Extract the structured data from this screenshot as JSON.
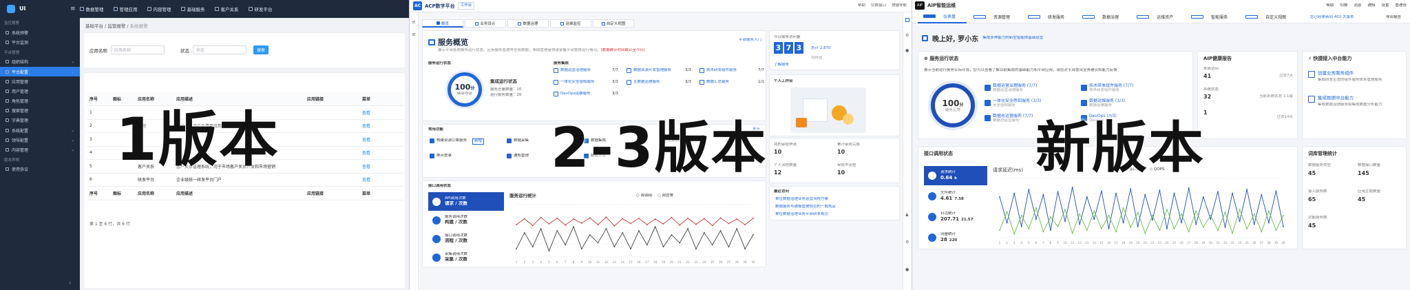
{
  "overlay": {
    "v1": "1版本",
    "v23": "2-3版本",
    "vnew": "新版本"
  },
  "p1": {
    "logo": "UI",
    "nav": [
      "数据管理",
      "管理应用",
      "内容管理",
      "基础服务",
      "客户关系",
      "研发平台"
    ],
    "side": [
      {
        "label": "监控报警",
        "type": "sec"
      },
      {
        "label": "系统预警",
        "type": "it"
      },
      {
        "label": "平台监测",
        "type": "it"
      },
      {
        "label": "平台管理",
        "type": "sec"
      },
      {
        "label": "组织结构",
        "type": "it",
        "chev": true
      },
      {
        "label": "平台配置",
        "type": "active",
        "chev": true
      },
      {
        "label": "应用管理",
        "type": "it"
      },
      {
        "label": "用户管理",
        "type": "it"
      },
      {
        "label": "角色管理",
        "type": "it"
      },
      {
        "label": "搜索管理",
        "type": "it"
      },
      {
        "label": "字典管理",
        "type": "it"
      },
      {
        "label": "系统配置",
        "type": "it",
        "chev": true
      },
      {
        "label": "领导配置",
        "type": "it",
        "chev": true
      },
      {
        "label": "内容管理",
        "type": "it",
        "chev": true
      },
      {
        "label": "版本声明",
        "type": "sec"
      },
      {
        "label": "使用协议",
        "type": "it"
      }
    ],
    "breadcrumb": [
      "基础平台",
      "监管报警",
      "系统报警"
    ],
    "filter": {
      "name_label": "应用名称",
      "name_ph": "应用名称",
      "status_label": "状态",
      "status_ph": "状态",
      "search": "搜索"
    },
    "columns": [
      "序号",
      "图标",
      "应用名称",
      "应用描述",
      "应用链接",
      "菜单"
    ],
    "rows": [
      [
        "1",
        "",
        "",
        "",
        "",
        "查看"
      ],
      [
        "2",
        "",
        "管理",
        "管理平台用户及费用应用配置等",
        "",
        "查看"
      ],
      [
        "3",
        "",
        "",
        "",
        "",
        "查看"
      ],
      [
        "4",
        "",
        "",
        "",
        "",
        "查看"
      ],
      [
        "5",
        "",
        "客户关系",
        "客户关系管理系统，用于市场客户关系开发和市场营销",
        "",
        "查看"
      ],
      [
        "6",
        "",
        "研发平台",
        "企业级统一研发平台门户",
        "",
        "查看"
      ]
    ],
    "footer_cols": [
      "序号",
      "图标",
      "应用名称",
      "应用描述",
      "应用链接",
      "菜单"
    ],
    "pager": "第 1 至 6 行，共 6 行"
  },
  "p2": {
    "brand": "ACP数字平台",
    "brand_tag": "工作台",
    "top_right": [
      "帮助",
      "切换窗口",
      "快捷导航"
    ],
    "tabs": [
      "概览",
      "业务设计",
      "数据治理",
      "运维监控",
      "自定义视图"
    ],
    "title": "服务概览",
    "subtitle": "展示平台各类服务运行状态、应用服务管理等全局数据，帮助管理者快速掌握平台整体运行情况。",
    "subtitle_note": "(数据统计时间截止至今日)",
    "entry": "平台服务入门",
    "counter_label": "今日服务访问量",
    "counter": [
      "3",
      "7",
      "3"
    ],
    "counter_side": "总计 2,870",
    "counter_sub": "月环比",
    "counter_link": "了解服务",
    "run_title": "服务运行状态",
    "ring_val": "100",
    "ring_unit": "分",
    "ring_sub": "健康等级",
    "run_info": [
      "集成运行状态",
      "服务总量数量：20",
      "运行服务数量：20"
    ],
    "svc_title": "服务集成",
    "svc": [
      [
        "数据运营治理服务",
        "7/7"
      ],
      [
        "数据资源开发管理服务",
        "3/3"
      ],
      [
        "技术研发组件服务",
        "7/7"
      ],
      [
        "一体化安全感知服务",
        "3/3"
      ],
      [
        "主数据治理服务",
        "3/3"
      ],
      [
        "数据汇总服务",
        "1/1"
      ],
      [
        "DevOps运维服务",
        "3/3"
      ]
    ],
    "apps_title": "常用功能",
    "apps_more": "更多",
    "apps": [
      "构建资源引擎服务",
      "新增",
      "数据采集",
      "数据集成",
      "主题模型",
      "单点登录",
      "通知管理",
      "数据开发"
    ],
    "workbench": "个人工作台",
    "stats": [
      [
        "我的审批申请",
        "10"
      ],
      [
        "累计审批完成",
        "10"
      ],
      [
        "个人流程数量",
        "12"
      ],
      [
        "审批中流程",
        "10"
      ]
    ],
    "links_title": "最近访问",
    "links": [
      "单位数据治理业务运营流程方案",
      "数据服务与通报管理规范的一般规定",
      "单位数据治理业务平台研发规范"
    ],
    "ops_title": "接口调用状态",
    "metrics": [
      [
        "API调用次数",
        "请求 / 次数"
      ],
      [
        "服务调用次数",
        "构建 / 次数"
      ],
      [
        "接口调用次数",
        "流程 / 次数"
      ],
      [
        "采集调用次数",
        "采集 / 次数"
      ]
    ],
    "chart_title": "服务运行统计",
    "legend": [
      "周调用",
      "周告警"
    ]
  },
  "p3": {
    "brand": "AIP智能运维",
    "top_right": [
      "帮助",
      "切换",
      "消息",
      "通知",
      "设置",
      "管理员"
    ],
    "menu": [
      "仪表盘",
      "资源管理",
      "研发服务",
      "数据治理",
      "运维资产",
      "智能服务",
      "自定义视图"
    ],
    "version": "您已经更新到 402 大版本",
    "export": "导出报告",
    "greet": "晚上好, 罗小东",
    "greet_sub": "集成多种能力的新型智能体基础运营",
    "run_title": "服务运行状态",
    "run_desc": "展示当前运行服务实际环境，您可以查看了解目前集成的基础能力和平台应用，请您对平台提出宝贵建议和能力反馈",
    "ring_val": "100",
    "ring_unit": "分",
    "ring_sub": "服务正常",
    "svc": [
      [
        "数据运营治理服务 (7/7)",
        "数据运营治理服务"
      ],
      [
        "技术研发组件服务 (7/7)",
        "技术研发组件服务"
      ],
      [
        "一体化安全感知服务 (3/3)",
        "安全感知服务"
      ],
      [
        "数据运维服务 (3/3)",
        "数据运维服务"
      ],
      [
        "数据总运营服务 (7/7)",
        "数据总运营服务"
      ],
      [
        "DevOps (3/3)",
        "DevOps"
      ]
    ],
    "report_title": "AIP健康报告",
    "report": [
      [
        "本周访问",
        "41",
        "过去7天"
      ],
      [
        "系统状态",
        "32",
        "当前系统状态 1.1版"
      ],
      [
        "",
        "1",
        "过去14天"
      ]
    ],
    "quick_title": "快捷接入中台能力",
    "quick": [
      [
        "创建业务服务组件",
        "集成研发生态的组件服务体系管理服务"
      ],
      [
        "集成数据中台能力",
        "集成数据治理服务和集成数据分析能力"
      ]
    ],
    "api_title": "接口调用状态",
    "metrics": [
      [
        "请求统计",
        "0.64",
        "k"
      ],
      [
        "文件统计",
        "4.61",
        "7.58"
      ],
      [
        "日活统计",
        "207.71",
        "21.57"
      ],
      [
        "流量统计",
        "28",
        "220"
      ]
    ],
    "chart_title": "请求延迟(ms)",
    "legend": [
      "接口调用",
      "QOPS"
    ],
    "dict_title": "词库管理统计",
    "dict": [
      [
        "数据服务类型",
        "45"
      ],
      [
        "数据接口数量",
        "145"
      ],
      [
        "接入服务数",
        "65"
      ],
      [
        "应用主题数量",
        "45"
      ],
      [
        "功能服务数",
        "45"
      ]
    ]
  },
  "chart_data": [
    {
      "type": "line",
      "title": "服务运行统计",
      "series": [
        {
          "name": "周调用",
          "values": [
            20,
            60,
            25,
            70,
            15,
            65,
            30,
            75,
            20,
            55,
            35,
            70,
            25,
            60,
            20,
            65,
            30,
            75,
            25,
            55,
            35,
            70,
            20,
            60,
            30,
            65,
            25,
            70,
            20,
            55
          ]
        },
        {
          "name": "周告警",
          "values": [
            80,
            95,
            78,
            98,
            82,
            96,
            79,
            94,
            84,
            97,
            80,
            99,
            77,
            95,
            83,
            96,
            80,
            94,
            82,
            98,
            79,
            96,
            81,
            95,
            78,
            97,
            83,
            94,
            80,
            96
          ]
        }
      ],
      "ylim": [
        0,
        130
      ]
    },
    {
      "type": "line",
      "title": "请求延迟(ms)",
      "series": [
        {
          "name": "接口调用",
          "values": [
            55,
            20,
            60,
            15,
            65,
            25,
            58,
            10,
            62,
            22,
            68,
            18,
            55,
            25,
            63,
            12,
            60,
            20,
            66,
            15,
            58,
            24,
            64,
            12,
            60,
            20,
            67,
            18,
            55,
            25,
            62,
            14,
            60,
            22,
            65,
            18,
            58,
            20,
            63,
            15
          ]
        },
        {
          "name": "QOPS",
          "values": [
            10,
            35,
            5,
            30,
            12,
            40,
            8,
            28,
            15,
            38,
            6,
            32,
            10,
            36,
            12,
            30,
            8,
            40,
            14,
            34,
            6,
            30,
            10,
            38,
            12,
            32,
            8,
            36,
            14,
            30,
            10,
            34,
            6,
            38,
            12,
            32,
            8,
            36,
            10,
            30
          ]
        }
      ],
      "ylim": [
        0,
        80
      ]
    }
  ]
}
